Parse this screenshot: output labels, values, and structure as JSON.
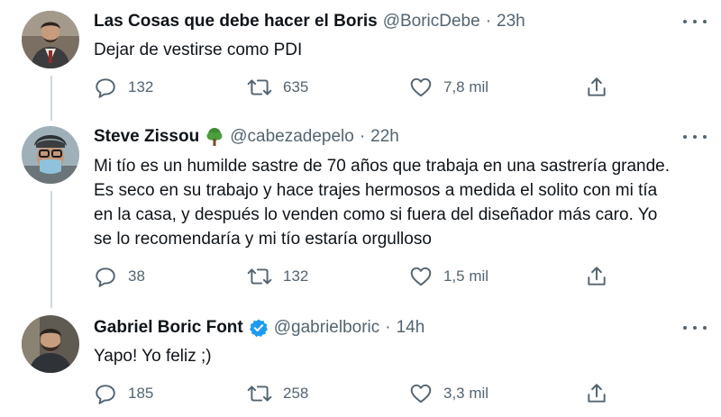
{
  "colors": {
    "text": "#0f1419",
    "secondary": "#536471",
    "verified": "#1d9bf0",
    "thread_line": "#cfd9de"
  },
  "tweets": [
    {
      "name": "Las Cosas que debe hacer el Boris",
      "handle": "@BoricDebe",
      "separator": "·",
      "time": "23h",
      "text": "Dejar de vestirse como PDI",
      "reply_count": "132",
      "retweet_count": "635",
      "like_count": "7,8 mil"
    },
    {
      "name": "Steve Zissou",
      "name_emoji": "tree-emoji-icon",
      "handle": "@cabezadepelo",
      "separator": "·",
      "time": "22h",
      "text": "Mi tío es un humilde sastre de 70 años que trabaja en una sastrería grande.\nEs seco en su trabajo y hace trajes hermosos a medida el solito con mi tía\nen la casa, y después lo venden como si fuera del diseñador más caro. Yo\nse lo recomendaría y mi tío estaría orgulloso",
      "reply_count": "38",
      "retweet_count": "132",
      "like_count": "1,5 mil"
    },
    {
      "name": "Gabriel Boric Font",
      "name_badge": "verified-badge-icon",
      "handle": "@gabrielboric",
      "separator": "·",
      "time": "14h",
      "text": "Yapo! Yo feliz ;)",
      "reply_count": "185",
      "retweet_count": "258",
      "like_count": "3,3 mil"
    }
  ]
}
